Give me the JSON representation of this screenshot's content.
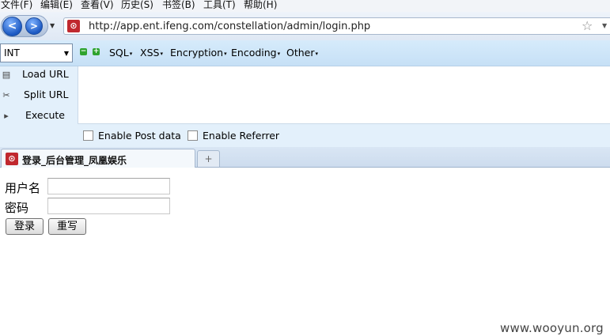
{
  "menu": [
    "文件(F)",
    "编辑(E)",
    "查看(V)",
    "历史(S)",
    "书签(B)",
    "工具(T)",
    "帮助(H)"
  ],
  "nav": {
    "back_label": "<",
    "forward_label": ">",
    "url": "http://app.ent.ifeng.com/constellation/admin/login.php",
    "favicon_glyph": "⊙"
  },
  "hackbar": {
    "select_value": "INT",
    "menus": [
      "SQL",
      "XSS",
      "Encryption",
      "Encoding",
      "Other"
    ],
    "actions": [
      "Load URL",
      "Split URL",
      "Execute"
    ],
    "post_checkbox_label": "Enable Post data",
    "referrer_checkbox_label": "Enable Referrer"
  },
  "tabs": {
    "active_title": "登录_后台管理_凤凰娱乐",
    "new_tab_glyph": "+"
  },
  "login_form": {
    "username_label": "用户名",
    "password_label": "密码",
    "username_value": "",
    "password_value": "",
    "submit_label": "登录",
    "reset_label": "重写"
  },
  "watermark": "www.wooyun.org",
  "colors": {
    "hackbar_bg": "#d6ebfb",
    "favicon": "#c0282e",
    "nav_button": "#1d59c2"
  }
}
